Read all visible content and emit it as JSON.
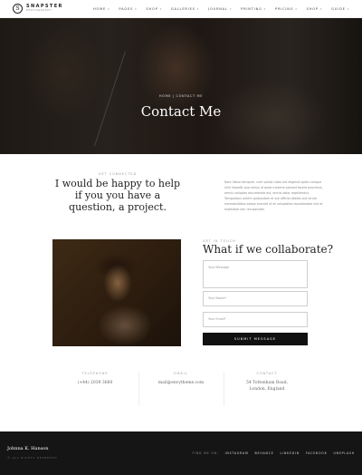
{
  "header": {
    "logo_mark": "S",
    "logo_name": "SNAPSTER",
    "logo_sub": "PHOTOGRAPHY",
    "nav": [
      {
        "label": "HOME"
      },
      {
        "label": "PAGES"
      },
      {
        "label": "SHOP"
      },
      {
        "label": "GALLERIES"
      },
      {
        "label": "JOURNAL"
      },
      {
        "label": "PRINTING"
      },
      {
        "label": "PRICING"
      },
      {
        "label": "SHOP"
      },
      {
        "label": "GUIDE"
      }
    ]
  },
  "hero": {
    "breadcrumb": "HOME | CONTACT ME",
    "title": "Contact Me"
  },
  "intro": {
    "label": "GET CONNECTED",
    "heading": "I would be happy to help if you you have a question, a project.",
    "text": "Nam libero tempore, cum soluta nobis est eligendi optio cumque nihil impedit quo minus id quod maxime placeat facere possimus, omnis voluptas assumenda est, omnis dolor repellendus. Temporibus autem quibusdam et aut officiis debitis aut rerum necessitatibus saepe eveniet ut et voluptates repudiandae sint et molestiae non recusandae."
  },
  "form": {
    "label": "GET IN TOUCH",
    "heading": "What if we collaborate?",
    "message_placeholder": "Your Message",
    "name_placeholder": "Your Name*",
    "email_placeholder": "Your Email*",
    "submit_label": "SUBMIT MESSAGE"
  },
  "contact": {
    "phone_label": "TELEPHONE",
    "phone": "(+44) 2039 3660",
    "email_label": "EMAIL",
    "email": "mail@envytheme.com",
    "address_label": "CONTACT",
    "address_line1": "54 Tottenham Road,",
    "address_line2": "London, England"
  },
  "footer": {
    "name": "Johnna K. Hanson",
    "copyright": "© ALL RIGHTS RESERVED",
    "social_label": "FIND ME ON:",
    "social": [
      "INSTAGRAM",
      "BEHANCE",
      "LINKEDIN",
      "FACEBOOK",
      "UNSPLASH"
    ]
  },
  "colors": {
    "footer_bg": "#151515",
    "button_bg": "#111111",
    "accent_text": "#999999"
  }
}
